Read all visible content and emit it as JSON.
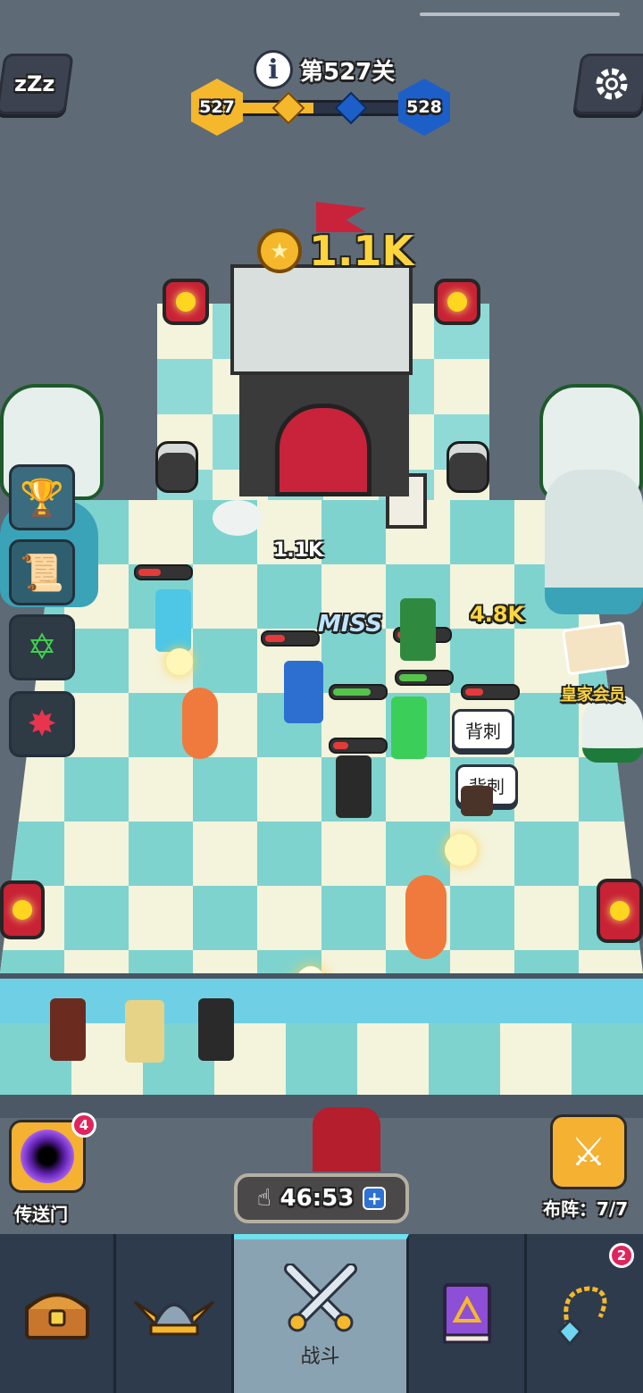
{
  "top_bar": {
    "level_title": "第527关",
    "current_level": "527",
    "next_level": "528",
    "sleep_icon": "sleep-zzz-icon",
    "settings_icon": "gear-icon",
    "info_icon": "info-icon"
  },
  "battle": {
    "gold_amount": "1.1K",
    "floating_texts": {
      "damage_1": "1.1K",
      "damage_2": "4.8K",
      "miss": "MISS"
    },
    "skill_labels": [
      "背刺",
      "背刺"
    ]
  },
  "side_menu": {
    "royal_member_label": "皇家会员"
  },
  "bottom_controls": {
    "portal_label": "传送门",
    "portal_badge": "4",
    "timer": "46:53",
    "formation_label": "布阵：",
    "formation_count": "7/7"
  },
  "nav": {
    "tabs": [
      {
        "id": "chest",
        "icon": "treasure-chest-icon",
        "label": ""
      },
      {
        "id": "heroes",
        "icon": "viking-helmet-icon",
        "label": ""
      },
      {
        "id": "battle",
        "icon": "crossed-swords-icon",
        "label": "战斗",
        "active": true
      },
      {
        "id": "spellbook",
        "icon": "spellbook-icon",
        "label": ""
      },
      {
        "id": "amulet",
        "icon": "amulet-icon",
        "label": "",
        "badge": "2"
      }
    ]
  },
  "colors": {
    "level_current": "#f5b82c",
    "level_next": "#1c5fc8",
    "accent_teal": "#7fd3cf",
    "hp_red": "#e53a3a",
    "hp_green": "#55c44a",
    "badge_pink": "#e0245e"
  },
  "progress": {
    "level_progress_fraction": 0.45
  }
}
